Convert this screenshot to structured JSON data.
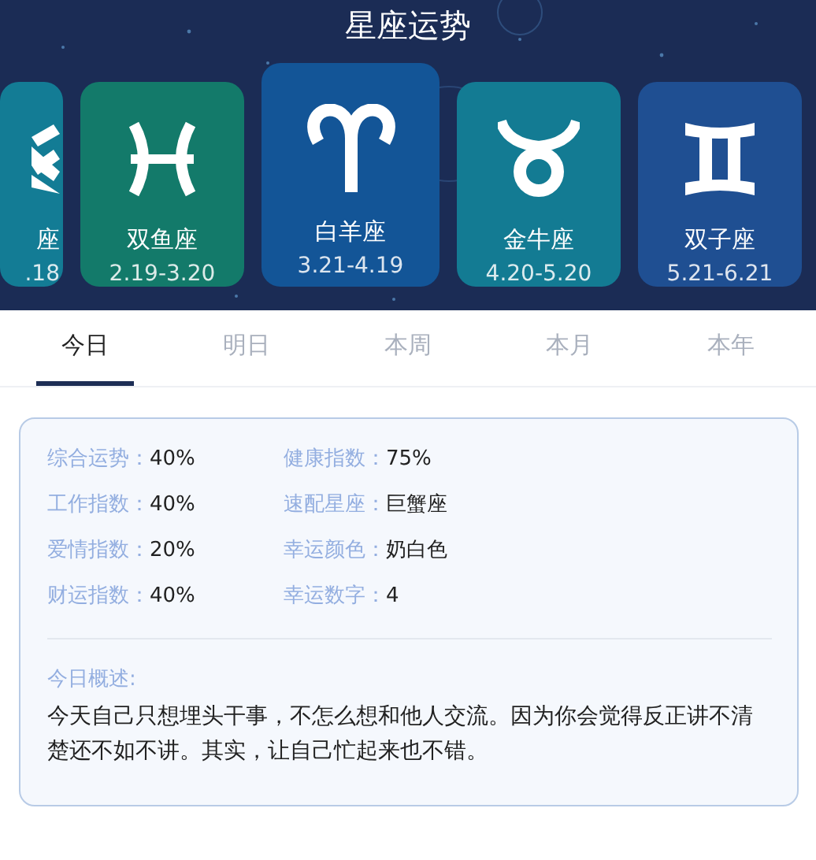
{
  "header": {
    "title": "星座运势"
  },
  "signs": [
    {
      "kind": "aquarius",
      "name": "座",
      "dates": ".18",
      "color": "#137c95",
      "selected": false
    },
    {
      "kind": "pisces",
      "name": "双鱼座",
      "dates": "2.19-3.20",
      "color": "#137a6a",
      "selected": false
    },
    {
      "kind": "aries",
      "name": "白羊座",
      "dates": "3.21-4.19",
      "color": "#135597",
      "selected": true
    },
    {
      "kind": "taurus",
      "name": "金牛座",
      "dates": "4.20-5.20",
      "color": "#137b93",
      "selected": false
    },
    {
      "kind": "gemini",
      "name": "双子座",
      "dates": "5.21-6.21",
      "color": "#1f4f92",
      "selected": false
    }
  ],
  "tabs": [
    {
      "label": "今日",
      "selected": true
    },
    {
      "label": "明日",
      "selected": false
    },
    {
      "label": "本周",
      "selected": false
    },
    {
      "label": "本月",
      "selected": false
    },
    {
      "label": "本年",
      "selected": false
    }
  ],
  "stats": [
    {
      "label": "综合运势：",
      "value": "40%"
    },
    {
      "label": "健康指数：",
      "value": "75%"
    },
    {
      "label": "工作指数：",
      "value": "40%"
    },
    {
      "label": "速配星座：",
      "value": "巨蟹座"
    },
    {
      "label": "爱情指数：",
      "value": "20%"
    },
    {
      "label": "幸运颜色：",
      "value": "奶白色"
    },
    {
      "label": "财运指数：",
      "value": "40%"
    },
    {
      "label": "幸运数字：",
      "value": "4"
    }
  ],
  "summary": {
    "heading": "今日概述:",
    "text": "今天自己只想埋头干事，不怎么想和他人交流。因为你会觉得反正讲不清楚还不如不讲。其实，让自己忙起来也不错。"
  }
}
